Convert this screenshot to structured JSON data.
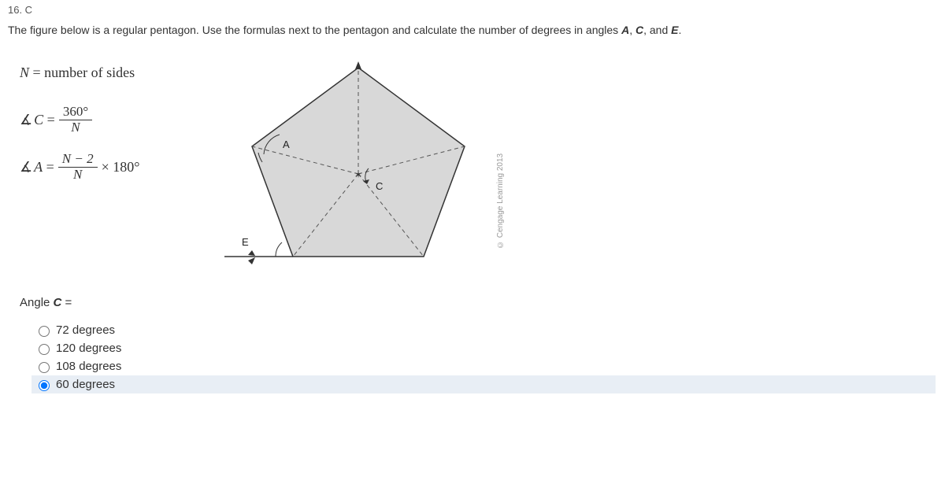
{
  "question_number": "16. C",
  "prompt_pre": "The figure below is a regular pentagon. Use the formulas next to the pentagon and calculate the number of degrees in angles ",
  "var_A": "A",
  "var_C": "C",
  "var_E": "E",
  "formulas": {
    "n_def": "N = number of sides",
    "c_label": "C =",
    "c_num": "360°",
    "c_den": "N",
    "a_label": "A =",
    "a_num": "N − 2",
    "a_den": "N",
    "a_mult": "× 180°"
  },
  "diagram": {
    "label_A": "A",
    "label_C": "C",
    "label_E": "E"
  },
  "copyright": "© Cengage Learning 2013",
  "answer_label": "Angle ",
  "answer_var": "C",
  "answer_eq": " =",
  "options": [
    {
      "label": "72 degrees",
      "selected": false
    },
    {
      "label": "120 degrees",
      "selected": false
    },
    {
      "label": "108 degrees",
      "selected": false
    },
    {
      "label": "60 degrees",
      "selected": true
    }
  ]
}
